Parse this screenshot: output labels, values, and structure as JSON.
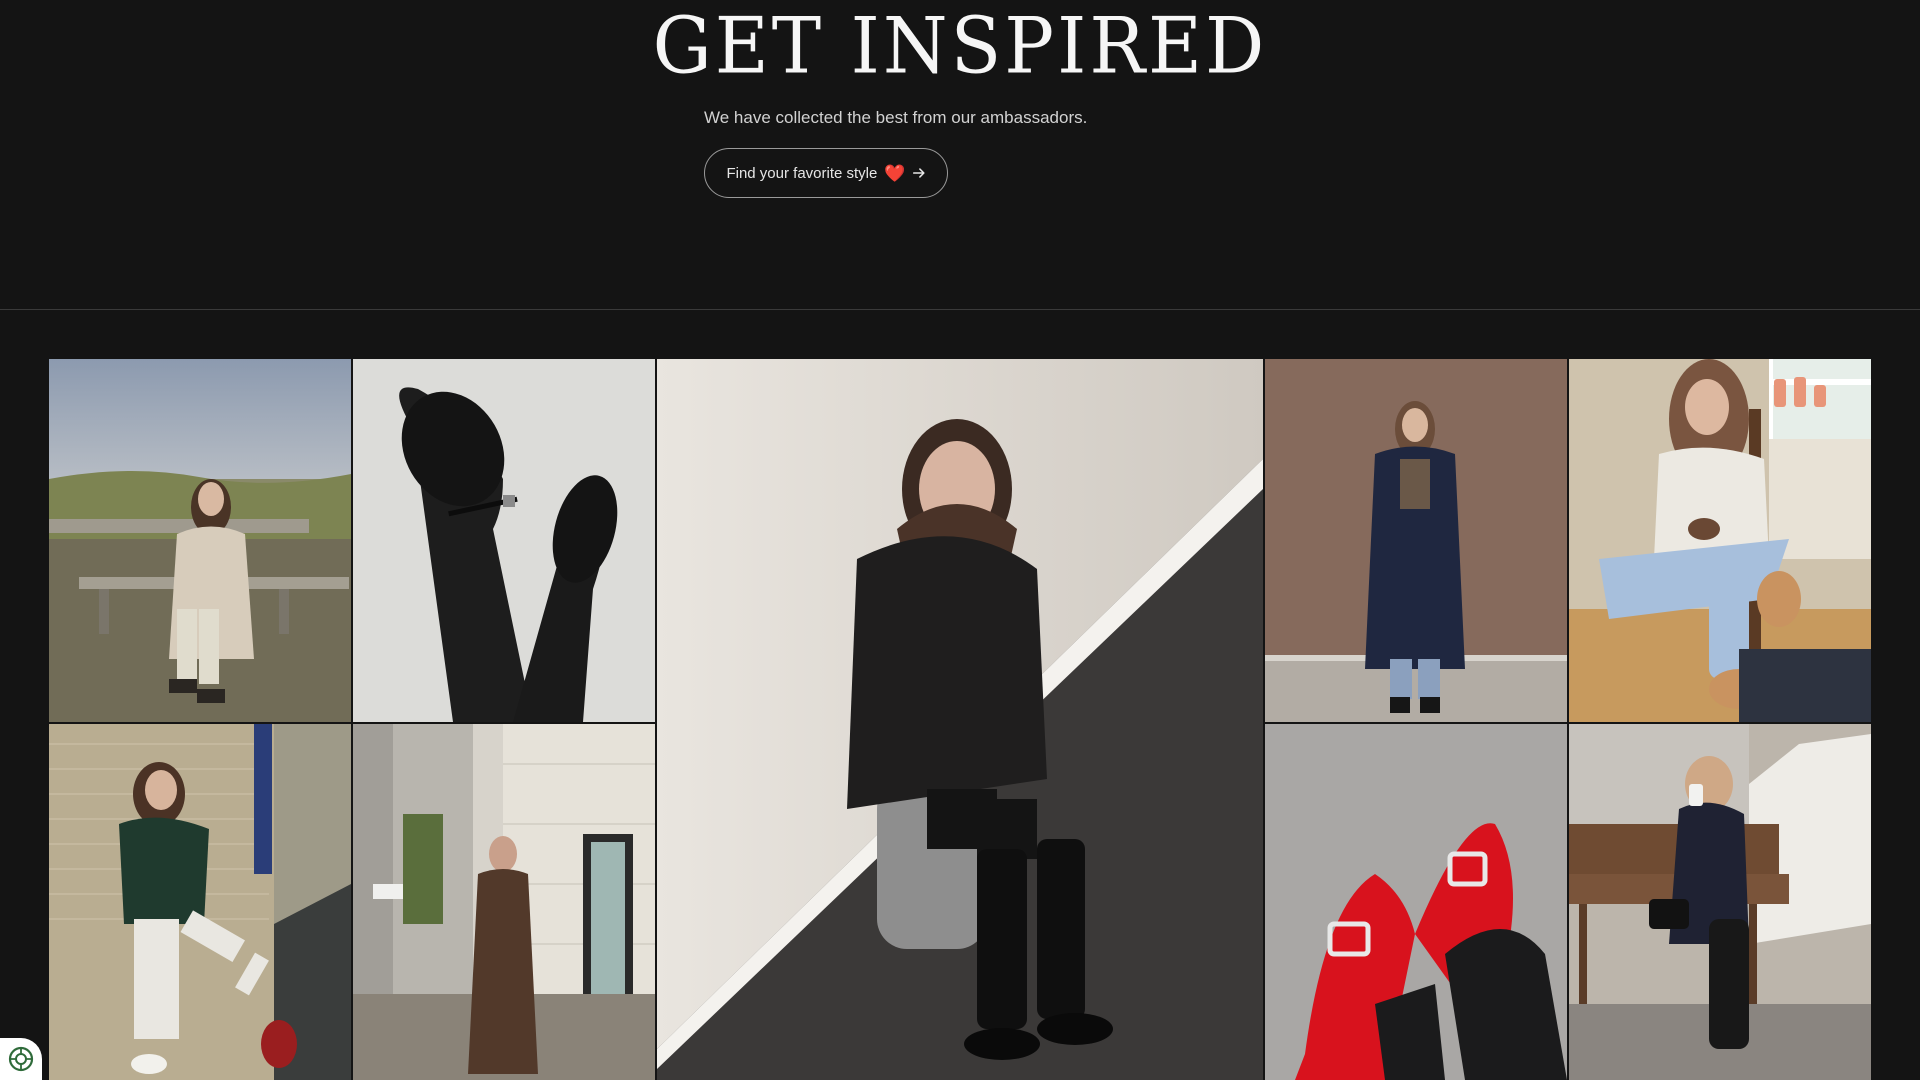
{
  "hero": {
    "title": "GET INSPIRED",
    "subtitle": "We have collected the best from our ambassadors.",
    "cta_label": "Find your favorite style",
    "cta_heart": "❤️",
    "cta_icon": "arrow-right-icon"
  },
  "gallery": {
    "tiles": [
      {
        "name": "gallery-photo-woman-bench-coast"
      },
      {
        "name": "gallery-photo-black-mary-jane-shoes"
      },
      {
        "name": "gallery-photo-woman-black-boots-sitting"
      },
      {
        "name": "gallery-photo-woman-navy-coat"
      },
      {
        "name": "gallery-photo-woman-knit-coffee"
      },
      {
        "name": "gallery-photo-woman-green-sweater-wall"
      },
      {
        "name": "gallery-photo-woman-brown-trench"
      },
      {
        "name": "gallery-photo-red-buckle-flats"
      },
      {
        "name": "gallery-photo-woman-bench-coffee-cup"
      }
    ]
  },
  "cookie_badge": {
    "icon": "cookie-settings-icon"
  },
  "colors": {
    "background": "#141414",
    "text": "#f6f6f6",
    "subtext": "#d2d2d2",
    "border": "#9a9a9a",
    "heart": "#e8344e"
  }
}
